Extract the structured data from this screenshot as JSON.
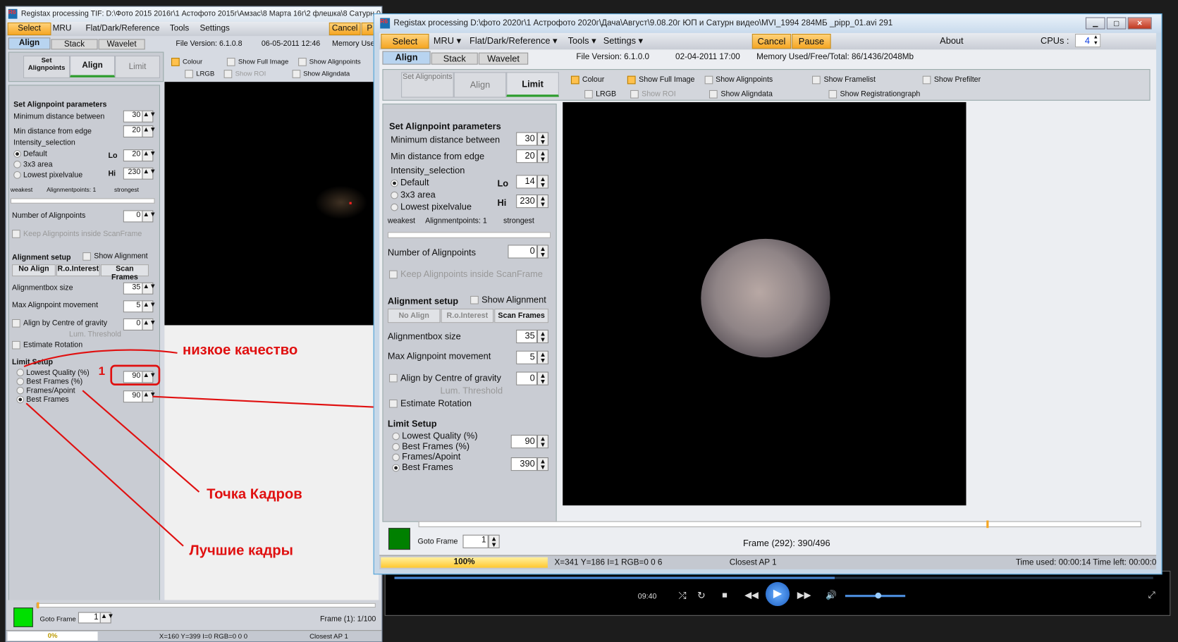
{
  "back_window": {
    "title": "Registax processing TIF: D:\\Фото 2015 2016г\\1 Астофото 2015г\\Амзас\\8 Марта 16г\\2 флешка\\8 Сатурн 0,3с",
    "menu": {
      "select": "Select",
      "mru": "MRU",
      "flat": "Flat/Dark/Reference",
      "tools": "Tools",
      "settings": "Settings",
      "cancel": "Cancel",
      "pause": "P"
    },
    "tabs": [
      "Align",
      "Stack",
      "Wavelet"
    ],
    "file_version": "File Version: 6.1.0.8",
    "date": "06-05-2011 12:46",
    "memory": "Memory Use",
    "subtabs": [
      "Set Alignpoints",
      "Align",
      "Limit"
    ],
    "checks": {
      "colour": "Colour",
      "full": "Show Full Image",
      "alignpoints": "Show Alignpoints",
      "lrgb": "LRGB",
      "roi": "Show ROI",
      "aligndata": "Show Aligndata"
    },
    "params": {
      "title": "Set Alignpoint parameters",
      "min_dist": "Minimum distance between",
      "min_dist_v": "30",
      "min_edge": "Min distance from edge",
      "min_edge_v": "20",
      "intensity": "Intensity_selection",
      "default": "Default",
      "area": "3x3 area",
      "lowest": "Lowest pixelvalue",
      "lo": "Lo",
      "lo_v": "20",
      "hi": "Hi",
      "hi_v": "230",
      "weakest": "weakest",
      "ap": "Alignmentpoints: 1",
      "strongest": "strongest",
      "num_ap": "Number of Alignpoints",
      "num_ap_v": "0",
      "keep": "Keep Alignpoints inside ScanFrame"
    },
    "setup": {
      "title": "Alignment setup",
      "show": "Show Alignment",
      "no_align": "No Align",
      "roi": "R.o.Interest",
      "scan": "Scan Frames",
      "box": "Alignmentbox size",
      "box_v": "35",
      "move": "Max Alignpoint movement",
      "move_v": "5",
      "cog": "Align by Centre of gravity",
      "cog_v": "0",
      "lum": "Lum. Threshold",
      "rot": "Estimate Rotation"
    },
    "limit": {
      "title": "Limit Setup",
      "lq": "Lowest Quality (%)",
      "lq_v": "90",
      "bfp": "Best Frames (%)",
      "fa": "Frames/Apoint",
      "bf": "Best Frames",
      "bf_v": "90"
    },
    "goto": "Goto Frame",
    "goto_v": "1",
    "frame": "Frame (1): 1/100",
    "status": {
      "progress": "0%",
      "progress_value": 0,
      "coords": "X=160 Y=399 I=0 RGB=0 0 0",
      "ap": "Closest AP 1"
    }
  },
  "front_window": {
    "title": "Registax processing D:\\фото 2020г\\1 Астрофото 2020г\\Дача\\Август\\9.08.20г ЮП и Сатурн видео\\MVI_1994 284МБ _pipp_01.avi 291",
    "menu": {
      "select": "Select",
      "mru": "MRU",
      "flat": "Flat/Dark/Reference",
      "tools": "Tools",
      "settings": "Settings",
      "cancel": "Cancel",
      "pause": "Pause",
      "about": "About",
      "cpus": "CPUs :",
      "cpus_v": "4"
    },
    "tabs": [
      "Align",
      "Stack",
      "Wavelet"
    ],
    "file_version": "File Version: 6.1.0.0",
    "date": "02-04-2011 17:00",
    "memory": "Memory Used/Free/Total: 86/1436/2048Mb",
    "subtabs": [
      "Set Alignpoints",
      "Align",
      "Limit"
    ],
    "checks": {
      "colour": "Colour",
      "full": "Show Full Image",
      "alignpoints": "Show Alignpoints",
      "framelist": "Show Framelist",
      "prefilter": "Show Prefilter",
      "lrgb": "LRGB",
      "roi": "Show ROI",
      "aligndata": "Show Aligndata",
      "reggraph": "Show Registrationgraph"
    },
    "params": {
      "title": "Set Alignpoint parameters",
      "min_dist": "Minimum distance between",
      "min_dist_v": "30",
      "min_edge": "Min distance from edge",
      "min_edge_v": "20",
      "intensity": "Intensity_selection",
      "default": "Default",
      "area": "3x3 area",
      "lowest": "Lowest pixelvalue",
      "lo": "Lo",
      "lo_v": "14",
      "hi": "Hi",
      "hi_v": "230",
      "weakest": "weakest",
      "ap": "Alignmentpoints: 1",
      "strongest": "strongest",
      "num_ap": "Number of Alignpoints",
      "num_ap_v": "0",
      "keep": "Keep Alignpoints inside ScanFrame"
    },
    "setup": {
      "title": "Alignment setup",
      "show": "Show Alignment",
      "no_align": "No Align",
      "roi": "R.o.Interest",
      "scan": "Scan Frames",
      "box": "Alignmentbox size",
      "box_v": "35",
      "move": "Max Alignpoint movement",
      "move_v": "5",
      "cog": "Align by Centre of gravity",
      "cog_v": "0",
      "lum": "Lum. Threshold",
      "rot": "Estimate Rotation"
    },
    "limit": {
      "title": "Limit Setup",
      "lq": "Lowest Quality (%)",
      "lq_v": "90",
      "bfp": "Best Frames (%)",
      "fa": "Frames/Apoint",
      "bf": "Best Frames",
      "bf_v": "390"
    },
    "goto": "Goto Frame",
    "goto_v": "1",
    "frame": "Frame (292): 390/496",
    "frame_slider_fraction": 0.786,
    "status": {
      "progress": "100%",
      "progress_value": 100,
      "coords": "X=341 Y=186 I=1 RGB=0 0 6",
      "ap": "Closest AP 1",
      "time": "Time used: 00:00:14 Time left: 00:00:0"
    }
  },
  "media_player": {
    "time": "09:40"
  },
  "annotations": {
    "low_quality": "низкое качество",
    "frames_point": "Точка Кадров",
    "best_frames": "Лучшие кадры",
    "marker": "1"
  },
  "colors": {
    "accent": "#f5a623",
    "annotation": "#e01010",
    "progress": "#ffd24d"
  }
}
